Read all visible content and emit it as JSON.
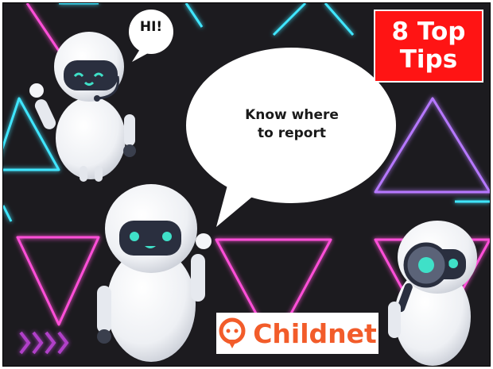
{
  "slide": {
    "badge": {
      "line1": "8 Top",
      "line2": "Tips",
      "bg_color": "#ff1414"
    },
    "greeting_bubble": {
      "text": "HI!"
    },
    "speech_bubble": {
      "line1": "Know where",
      "line2": "to report"
    },
    "logo": {
      "text": "Childnet",
      "icon": "childnet-speech-icon",
      "color": "#f25c2a"
    },
    "decor": {
      "neon_pink": "#ff4fd8",
      "neon_cyan": "#3fe6ff",
      "chevron_icon": "triple-chevron-icon",
      "chevron_color": "#b040c8"
    }
  }
}
